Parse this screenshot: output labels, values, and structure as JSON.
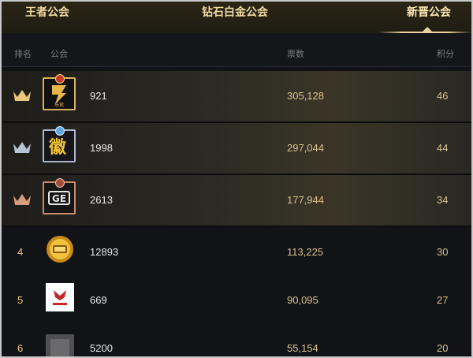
{
  "tabs": [
    "王者公会",
    "钻石白金公会",
    "新晋公会"
  ],
  "columns": {
    "rank": "排名",
    "guild": "公会",
    "votes": "票数",
    "score": "积分"
  },
  "rows": [
    {
      "rank": "",
      "crown": "gold-crown-icon",
      "logo_text": "乐竞",
      "name": "921",
      "votes": "305,128",
      "score": "46"
    },
    {
      "rank": "",
      "crown": "silver-crown-icon",
      "logo_text": "徽",
      "name": "1998",
      "votes": "297,044",
      "score": "44"
    },
    {
      "rank": "",
      "crown": "bronze-crown-icon",
      "logo_text": "GE",
      "name": "2613",
      "votes": "177,944",
      "score": "34"
    },
    {
      "rank": "4",
      "crown": "",
      "logo_text": "",
      "name": "12893",
      "votes": "113,225",
      "score": "30"
    },
    {
      "rank": "5",
      "crown": "",
      "logo_text": "",
      "name": "669",
      "votes": "90,095",
      "score": "27"
    },
    {
      "rank": "6",
      "crown": "",
      "logo_text": "",
      "name": "5200",
      "votes": "55,154",
      "score": "20"
    }
  ],
  "colors": {
    "gold": "#e8c67a",
    "silver": "#b9c3d6",
    "bronze": "#d99b7e",
    "accent": "#ead39d"
  }
}
